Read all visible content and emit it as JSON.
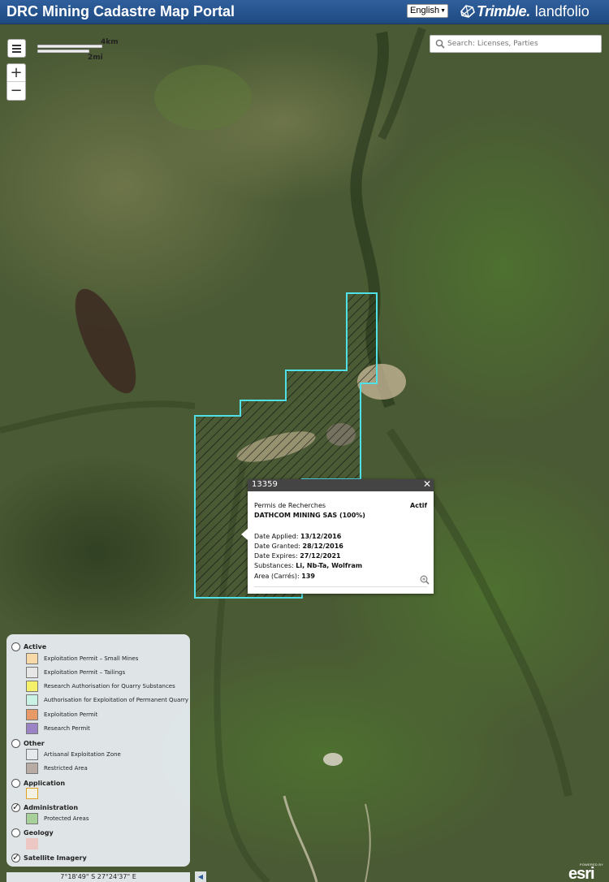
{
  "header": {
    "title": "DRC Mining Cadastre Map Portal",
    "language": "English",
    "brand_name": "Trimble.",
    "brand_product": "landfolio"
  },
  "search": {
    "placeholder": "Search: Licenses, Parties",
    "icon": "search-icon"
  },
  "map_controls": {
    "zoom_in": "+",
    "zoom_out": "−",
    "menu_icon": "hamburger-icon"
  },
  "scalebar": {
    "km_label": "4km",
    "mi_label": "2mi"
  },
  "popup": {
    "title": "13359",
    "close": "✕",
    "license_type": "Permis de Recherches",
    "status": "Actif",
    "holder": "DATHCOM MINING SAS (100%)",
    "fields": [
      {
        "label": "Date Applied: ",
        "value": "13/12/2016"
      },
      {
        "label": "Date Granted: ",
        "value": "28/12/2016"
      },
      {
        "label": "Date Expires: ",
        "value": "27/12/2021"
      },
      {
        "label": "Substances: ",
        "value": "Li, Nb-Ta, Wolfram"
      },
      {
        "label": "Area (Carrés): ",
        "value": "139"
      }
    ]
  },
  "legend": {
    "groups": [
      {
        "label": "Active",
        "checked": false
      },
      {
        "label": "Other",
        "checked": false
      },
      {
        "label": "Application",
        "checked": false
      },
      {
        "label": "Administration",
        "checked": true
      },
      {
        "label": "Geology",
        "checked": false
      },
      {
        "label": "Satellite Imagery",
        "checked": true
      }
    ],
    "items": [
      {
        "label": "Exploitation Permit – Small Mines",
        "color": "#f7d9a8"
      },
      {
        "label": "Exploitation Permit – Tailings",
        "color": "#e6e6e6"
      },
      {
        "label": "Research Authorisation for Quarry Substances",
        "color": "#f4f06a"
      },
      {
        "label": "Authorisation for Exploitation of Permanent Quarry",
        "color": "#c9f2e4"
      },
      {
        "label": "Exploitation Permit",
        "color": "#e79a66"
      },
      {
        "label": "Research Permit",
        "color": "#9a84c6"
      },
      {
        "label": "Artisanal Exploitation Zone",
        "color": "#e4e9ec"
      },
      {
        "label": "Restricted Area",
        "color": "#b8aba4"
      },
      {
        "label": "",
        "color": "#f3f0e4"
      },
      {
        "label": "Protected Areas",
        "color": "#a7cf9a"
      },
      {
        "label": "",
        "color": "#ecc7c4"
      }
    ]
  },
  "coordinates": "7°18'49\" S  27°24'37\" E",
  "attribution": {
    "powered": "POWERED BY",
    "word": "esri"
  }
}
